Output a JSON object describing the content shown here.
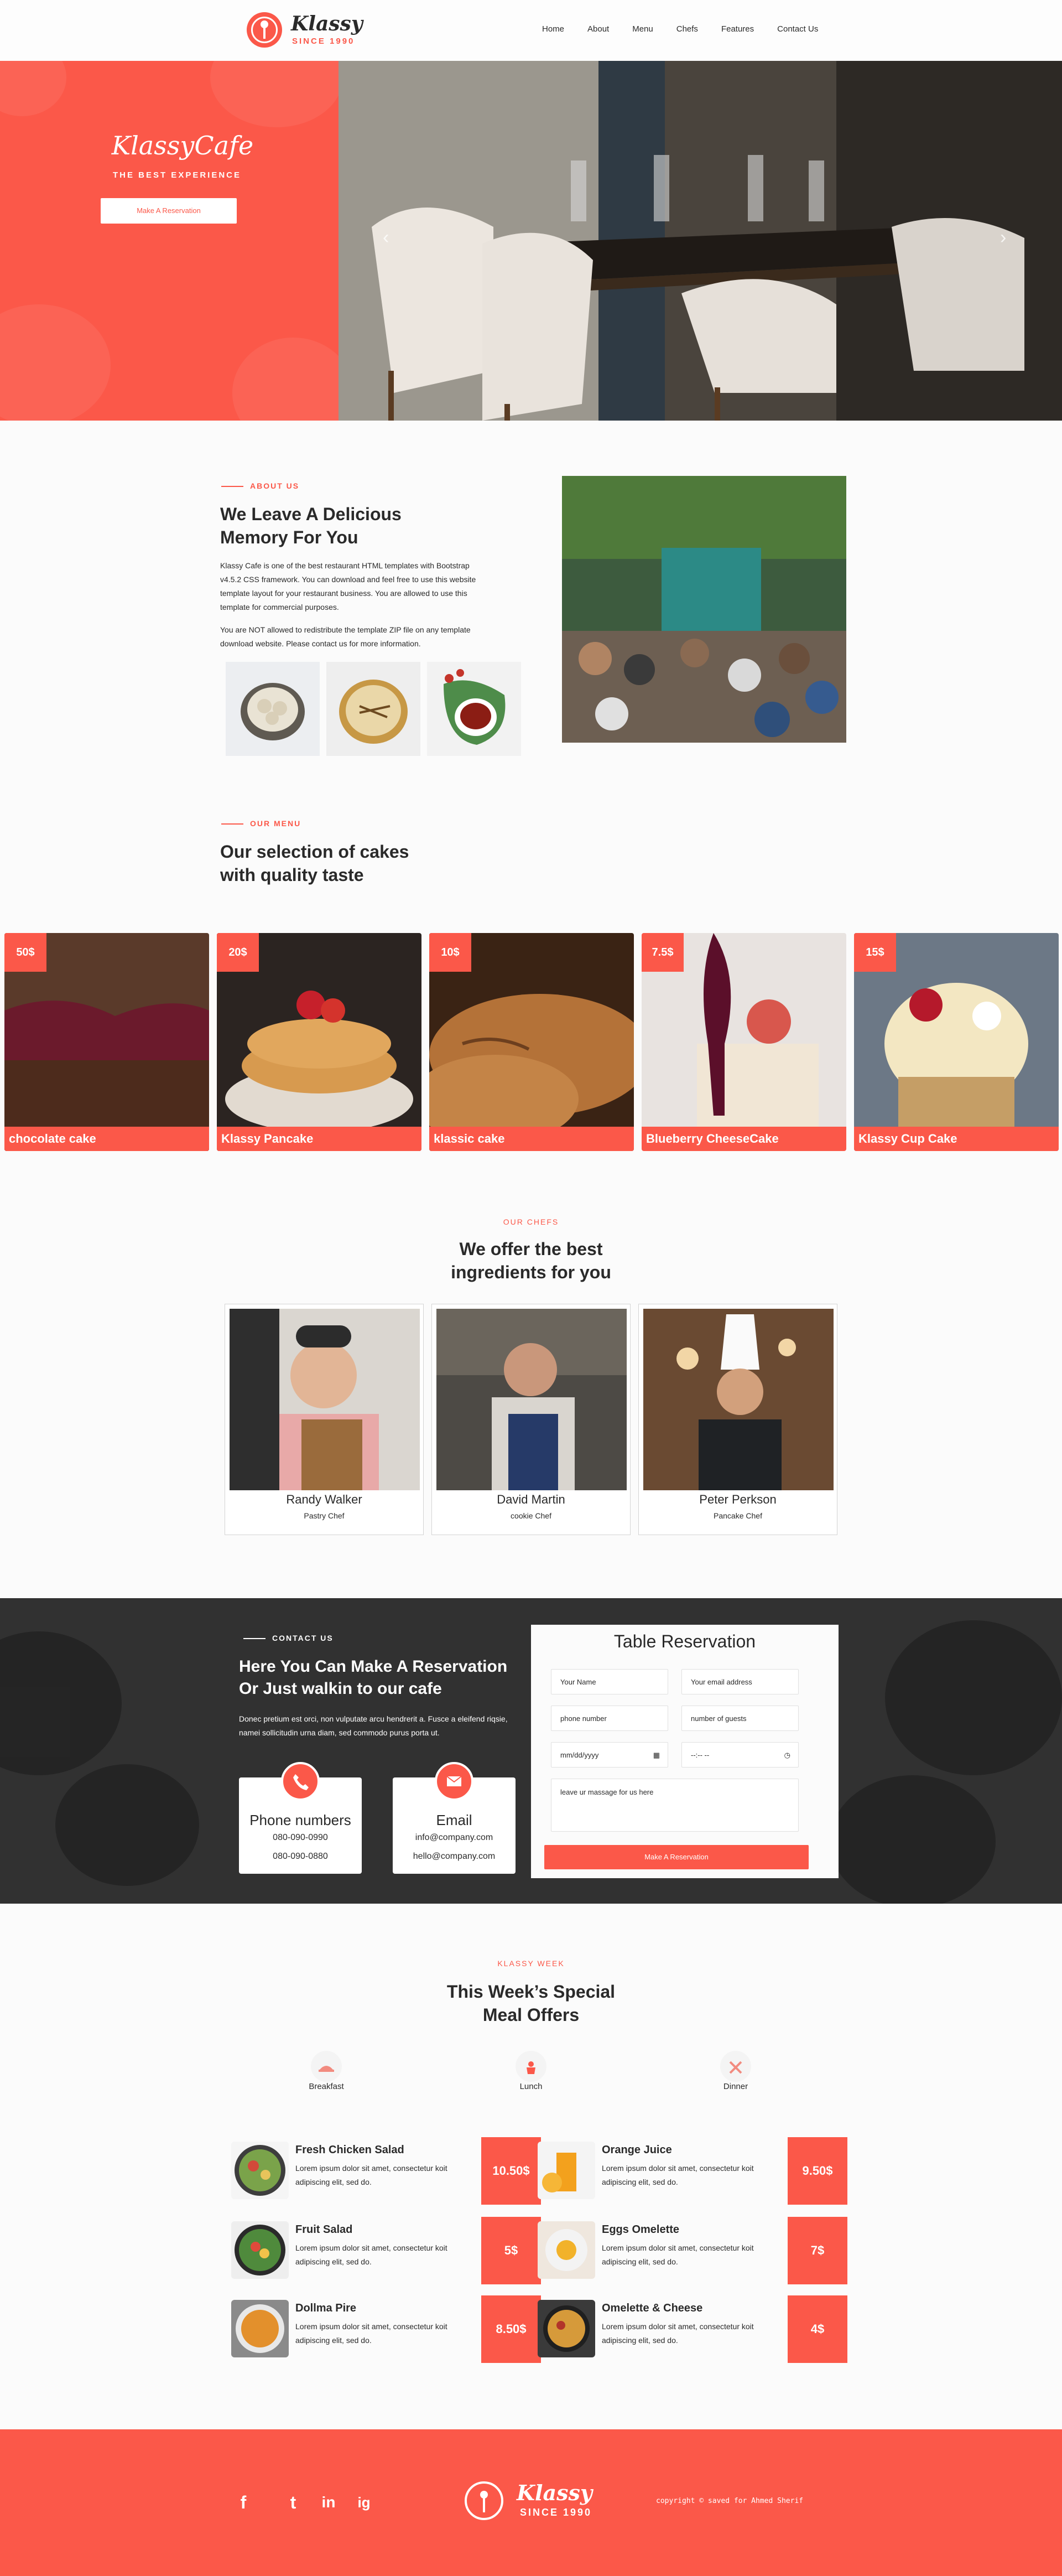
{
  "header": {
    "logo_word": "Klassy",
    "logo_since": "SINCE 1990",
    "nav": [
      "Home",
      "About",
      "Menu",
      "Chefs",
      "Features",
      "Contact Us"
    ]
  },
  "hero": {
    "title": "KlassyCafe",
    "subtitle": "THE BEST EXPERIENCE",
    "button": "Make A Reservation",
    "prev": "‹",
    "next": "›"
  },
  "about": {
    "tag": "ABOUT US",
    "heading_line1": "We Leave A Delicious",
    "heading_line2": "Memory For You",
    "para1": "Klassy Cafe is one of the best restaurant HTML templates with Bootstrap v4.5.2 CSS framework. You can download and feel free to use this website template layout for your restaurant business. You are allowed to use this template for commercial purposes.",
    "para2": "You are NOT allowed to redistribute the template ZIP file on any template download website. Please contact us for more information."
  },
  "menu": {
    "tag": "OUR MENU",
    "heading_line1": "Our selection of cakes",
    "heading_line2": "with quality taste",
    "items": [
      {
        "price": "50$",
        "name": "chocolate cake"
      },
      {
        "price": "20$",
        "name": "Klassy Pancake"
      },
      {
        "price": "10$",
        "name": "klassic cake"
      },
      {
        "price": "7.5$",
        "name": "Blueberry CheeseCake"
      },
      {
        "price": "15$",
        "name": "Klassy Cup Cake"
      }
    ]
  },
  "chefs": {
    "tag": "OUR CHEFS",
    "heading_line1": "We offer the best",
    "heading_line2": "ingredients for you",
    "items": [
      {
        "name": "Randy Walker",
        "role": "Pastry Chef"
      },
      {
        "name": "David Martin",
        "role": "cookie Chef"
      },
      {
        "name": "Peter Perkson",
        "role": "Pancake Chef"
      }
    ]
  },
  "reservation": {
    "tag": "CONTACT US",
    "heading_line1": "Here You Can Make A Reservation",
    "heading_line2": "Or Just walkin to our cafe",
    "para": "Donec pretium est orci, non vulputate arcu hendrerit a. Fusce a eleifend riqsie, namei sollicitudin urna diam, sed commodo purus porta ut.",
    "phone_title": "Phone numbers",
    "phone1": "080-090-0990",
    "phone2": "080-090-0880",
    "email_title": "Email",
    "email1": "info@company.com",
    "email2": "hello@company.com",
    "form_title": "Table Reservation",
    "name_ph": "Your Name",
    "email_ph": "Your email address",
    "phone_ph": "phone number",
    "guests_ph": "number of guests",
    "date_ph": "mm/dd/yyyy",
    "time_ph": "--:-- --",
    "message_ph": "leave ur massage for us here",
    "submit": "Make A Reservation"
  },
  "week": {
    "tag": "KLASSY WEEK",
    "heading_line1": "This Week’s Special",
    "heading_line2": "Meal Offers",
    "tabs": [
      "Breakfast",
      "Lunch",
      "Dinner"
    ],
    "desc": "Lorem ipsum dolor sit amet, consectetur koit adipiscing elit, sed do.",
    "left": [
      {
        "name": "Fresh Chicken Salad",
        "price": "10.50$"
      },
      {
        "name": "Fruit Salad",
        "price": "5$"
      },
      {
        "name": "Dollma Pire",
        "price": "8.50$"
      }
    ],
    "right": [
      {
        "name": "Orange Juice",
        "price": "9.50$"
      },
      {
        "name": "Eggs Omelette",
        "price": "7$"
      },
      {
        "name": "Omelette & Cheese",
        "price": "4$"
      }
    ]
  },
  "footer": {
    "logo_word": "Klassy",
    "logo_since": "SINCE 1990",
    "copyright": "copyright © saved for Ahmed Sherif",
    "social": [
      "f",
      "t",
      "in",
      "ig"
    ]
  },
  "colors": {
    "accent": "#fb5849",
    "dark": "#313131",
    "text": "#2a2a2a"
  }
}
